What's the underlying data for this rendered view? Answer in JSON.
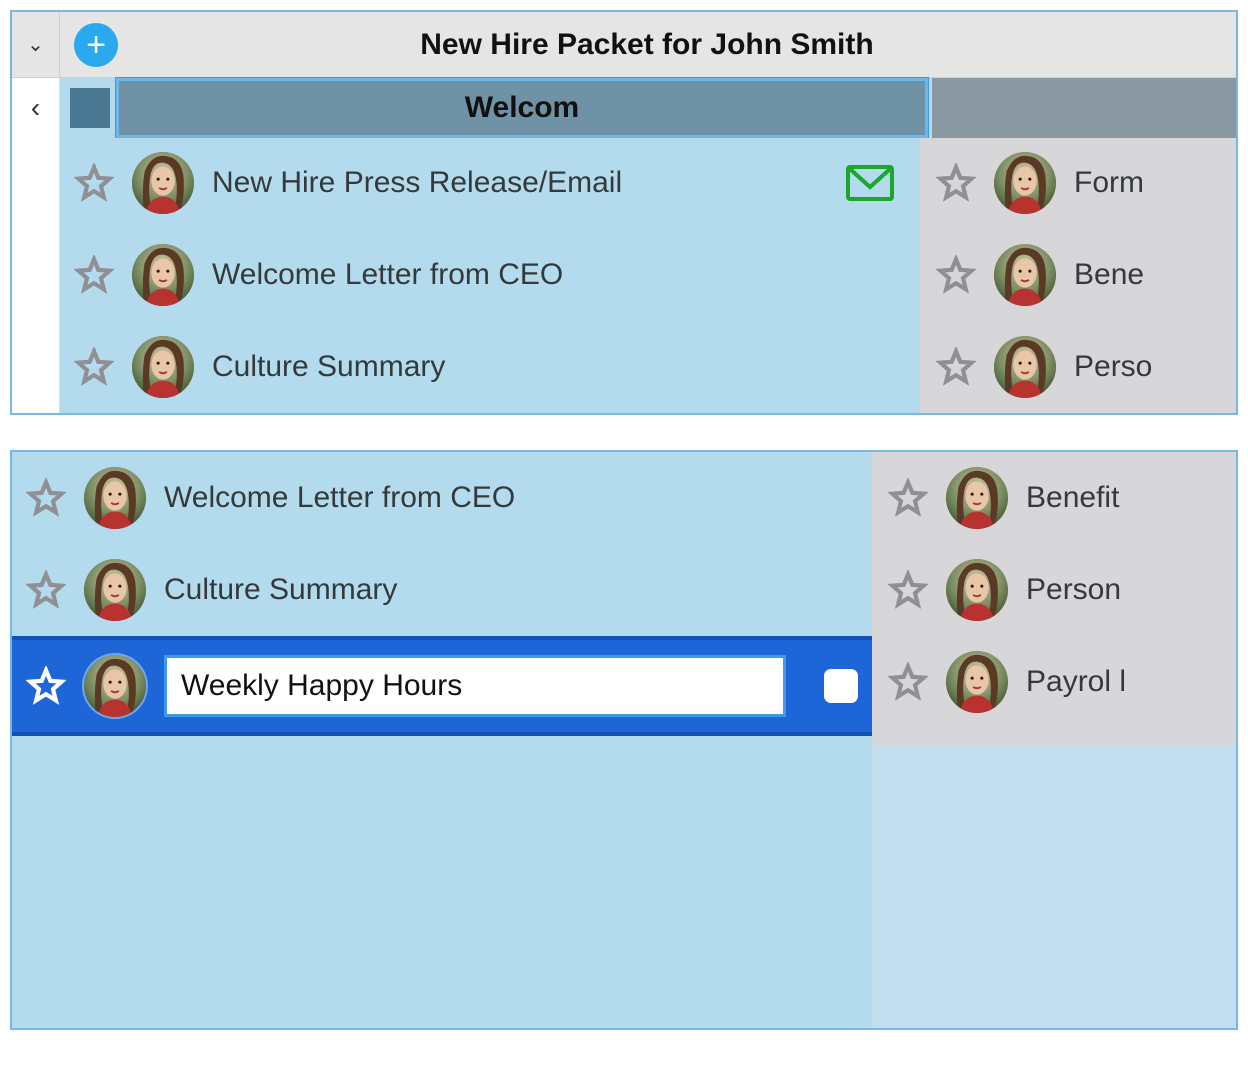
{
  "header": {
    "title": "New Hire Packet for John Smith",
    "col1_input": "Welcom",
    "add_label": "+",
    "back_label": "‹"
  },
  "panel1": {
    "left": [
      {
        "title": "New Hire Press Release/Email",
        "hasMail": true
      },
      {
        "title": "Welcome Letter from CEO",
        "hasMail": false
      },
      {
        "title": "Culture Summary",
        "hasMail": false
      }
    ],
    "right": [
      {
        "title": "Form"
      },
      {
        "title": "Bene"
      },
      {
        "title": "Perso"
      }
    ]
  },
  "panel2": {
    "left": [
      {
        "title": "Welcome Letter from CEO"
      },
      {
        "title": "Culture Summary"
      }
    ],
    "editing": {
      "value": "Weekly Happy Hours"
    },
    "right": [
      {
        "title": "Benefit"
      },
      {
        "title": "Person"
      },
      {
        "title": "Payrol l"
      }
    ]
  },
  "icons": {
    "avatar_alt": "assignee-avatar"
  }
}
